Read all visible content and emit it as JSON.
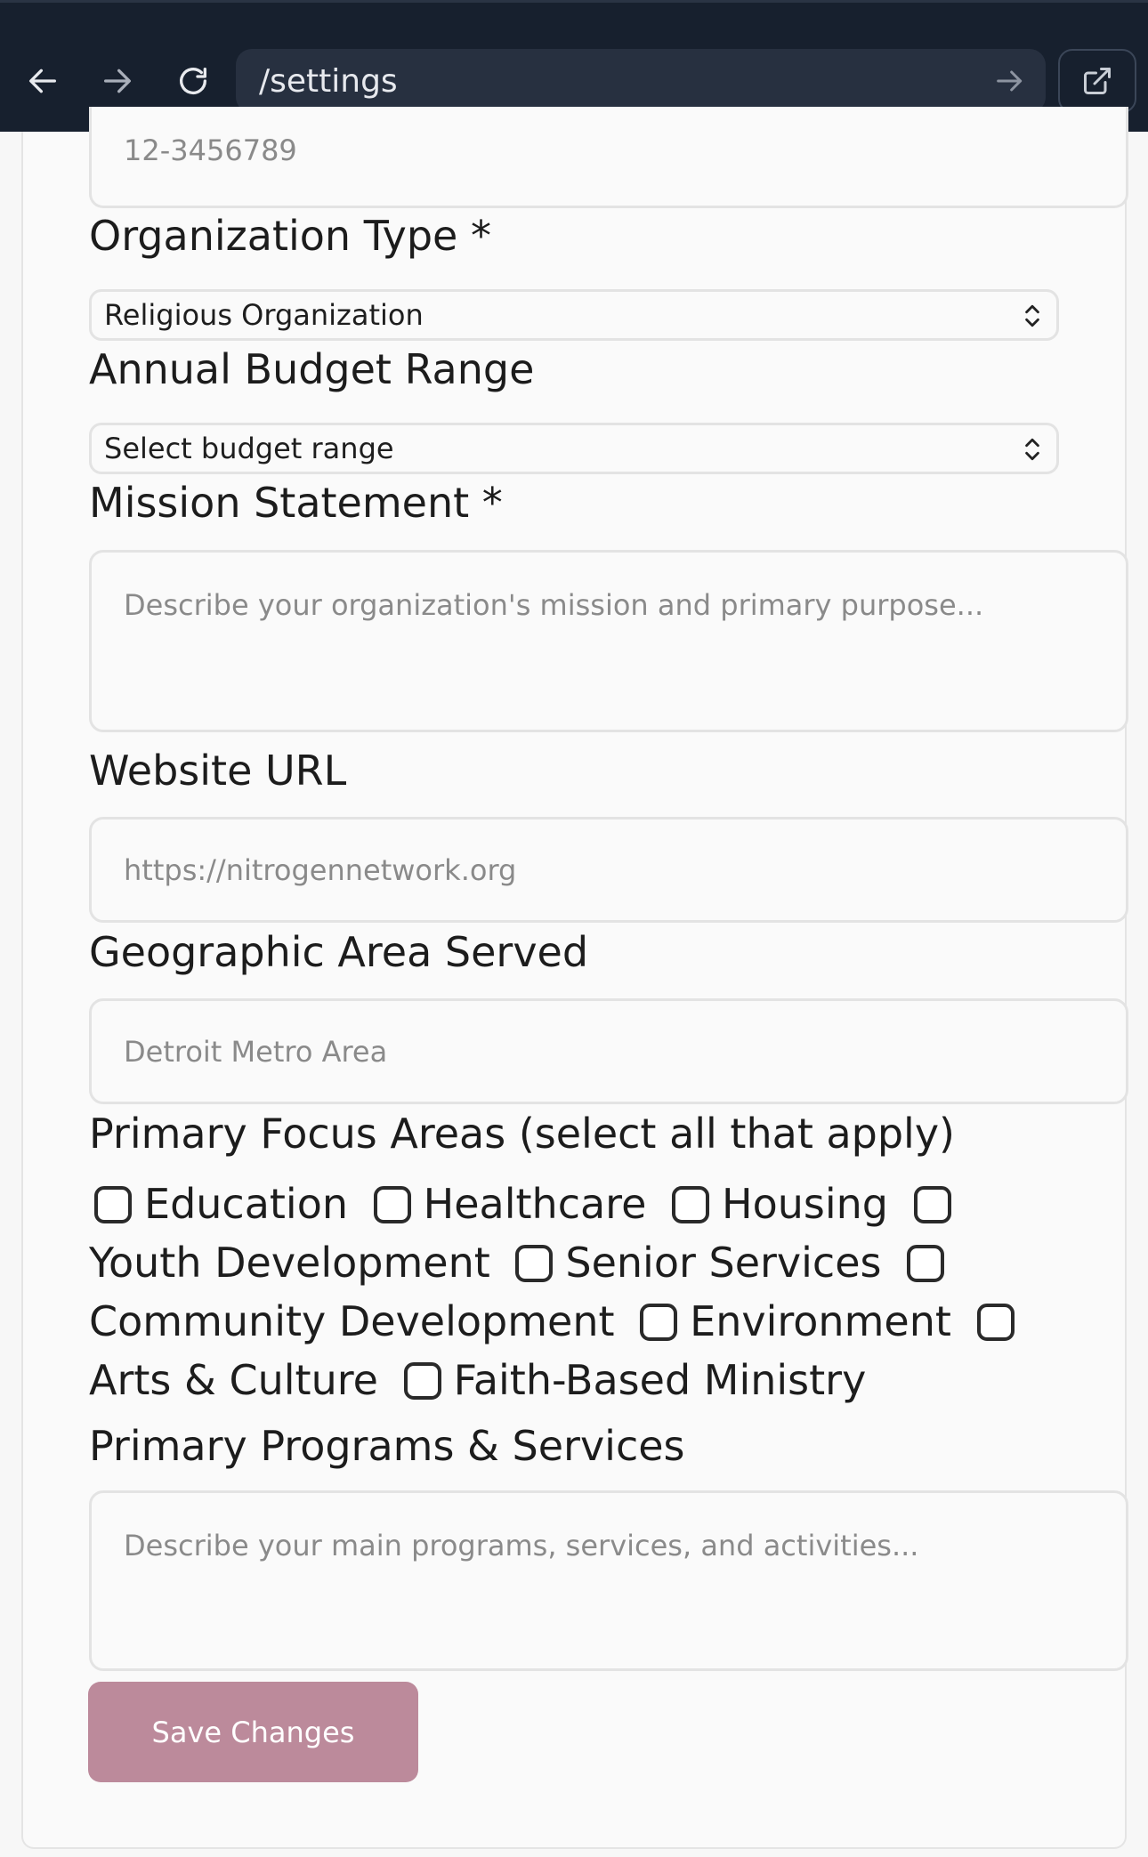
{
  "browser": {
    "url": "/settings"
  },
  "form": {
    "ein_placeholder": "12-3456789",
    "org_type": {
      "label": "Organization Type *",
      "selected": "Religious Organization"
    },
    "budget": {
      "label": "Annual Budget Range",
      "selected": "Select budget range"
    },
    "mission": {
      "label": "Mission Statement *",
      "placeholder": "Describe your organization's mission and primary purpose..."
    },
    "website": {
      "label": "Website URL",
      "placeholder": "https://nitrogennetwork.org"
    },
    "geo": {
      "label": "Geographic Area Served",
      "placeholder": "Detroit Metro Area"
    },
    "focus": {
      "label": "Primary Focus Areas (select all that apply)",
      "options": [
        "Education",
        "Healthcare",
        "Housing",
        "Youth Development",
        "Senior Services",
        "Community Development",
        "Environment",
        "Arts & Culture",
        "Faith-Based Ministry"
      ]
    },
    "programs": {
      "label": "Primary Programs & Services",
      "placeholder": "Describe your main programs, services, and activities..."
    },
    "save_label": "Save Changes"
  },
  "colors": {
    "browser_bar": "#17202e",
    "save_button": "#bc8a9b"
  }
}
